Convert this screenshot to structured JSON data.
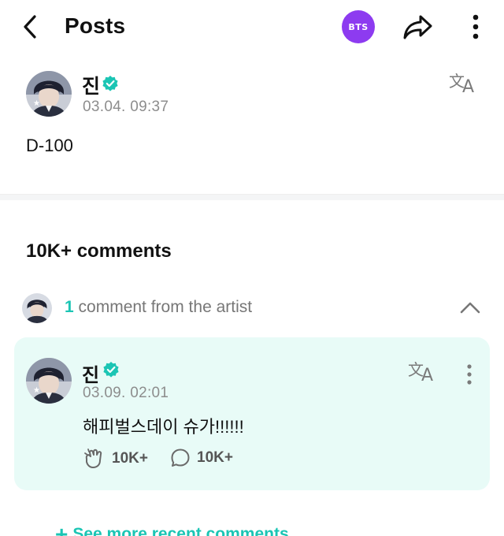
{
  "header": {
    "title": "Posts",
    "badge": "BTS",
    "back_icon": "chevron-left-icon",
    "share_icon": "share-arrow-icon",
    "more_icon": "vertical-dots-icon",
    "badge_color": "#8d3bf0"
  },
  "post": {
    "author": "진",
    "timestamp": "03.04. 09:37",
    "body": "D-100",
    "verified_icon": "verified-check-icon",
    "translate_icon": "translate-icon"
  },
  "comments": {
    "title": "10K+ comments",
    "artist_count": "1",
    "artist_label": "comment from the artist",
    "collapse_icon": "chevron-up-icon",
    "accent_color": "#1bc5b4",
    "artist_comment": {
      "author": "진",
      "timestamp": "03.09. 02:01",
      "text": "해피벌스데이 슈가!!!!!!",
      "likes": "10K+",
      "replies": "10K+",
      "like_icon": "cheer-hand-icon",
      "reply_icon": "speech-bubble-icon",
      "card_color": "#e8fbf7"
    },
    "see_more": "See more recent comments"
  }
}
